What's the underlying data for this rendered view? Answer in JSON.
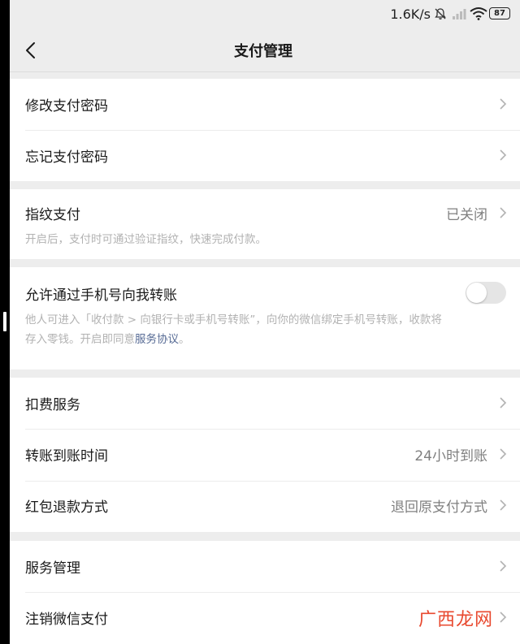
{
  "status_bar": {
    "speed": "1.6K/s",
    "battery": "87",
    "icons": [
      "bell-muted-icon",
      "signal-icon",
      "wifi-icon",
      "battery-icon"
    ]
  },
  "nav": {
    "title": "支付管理",
    "back_icon": "chevron-left-icon"
  },
  "groups": {
    "password": {
      "change_label": "修改支付密码",
      "forgot_label": "忘记支付密码"
    },
    "fingerprint": {
      "label": "指纹支付",
      "value": "已关闭",
      "description": "开启后，支付时可通过验证指纹，快速完成付款。"
    },
    "phone_transfer": {
      "label": "允许通过手机号向我转账",
      "toggle_on": false,
      "description_line1": "他人可进入「收付款 > 向银行卡或手机号转账”，向你的微信绑定手机号转账，收款将",
      "description_line2_prefix": "存入零钱。开启即同意",
      "description_link": "服务协议",
      "description_line2_suffix": "。"
    },
    "services": {
      "deduction_label": "扣费服务",
      "transfer_time_label": "转账到账时间",
      "transfer_time_value": "24小时到账",
      "refund_label": "红包退款方式",
      "refund_value": "退回原支付方式"
    },
    "manage": {
      "service_manage_label": "服务管理",
      "cancel_pay_label": "注销微信支付"
    }
  },
  "watermark": "广西龙网",
  "colors": {
    "background": "#ededed",
    "card": "#ffffff",
    "secondary_text": "#7f7f7f",
    "hint_text": "#b2b2b2",
    "link": "#576b95",
    "watermark": "#e8492f"
  }
}
